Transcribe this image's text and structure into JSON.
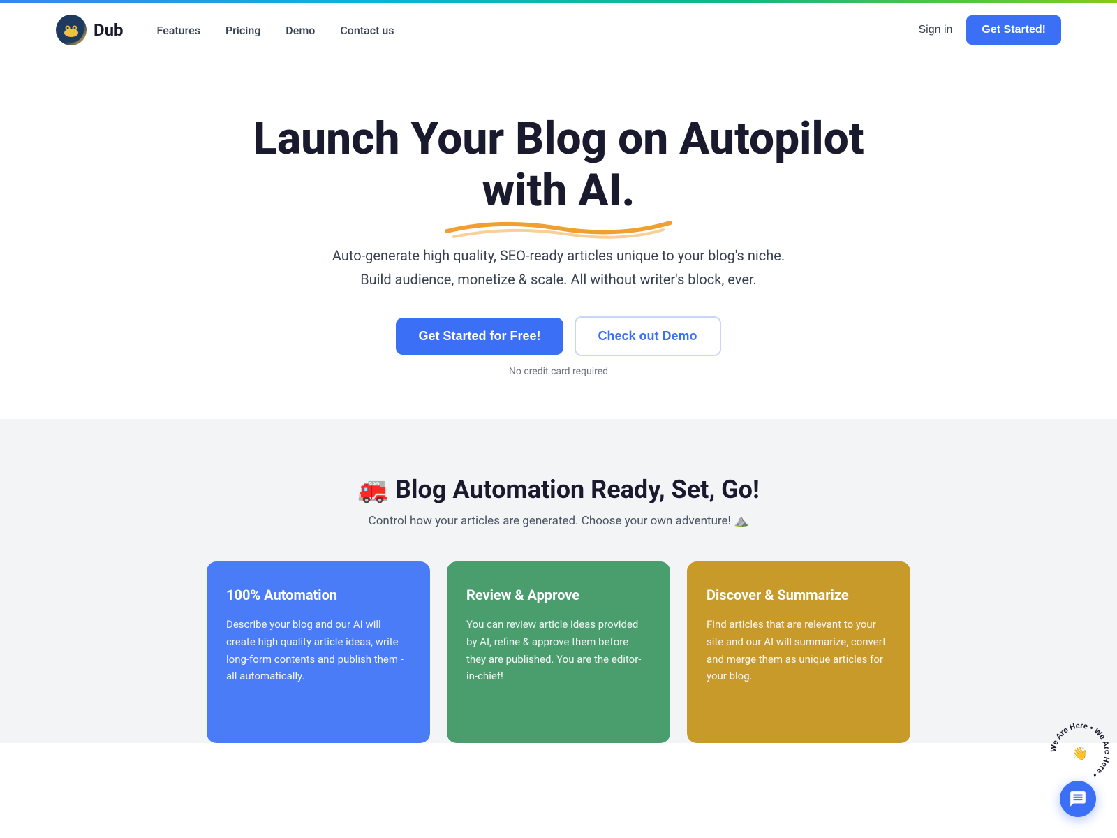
{
  "topbar": {},
  "navbar": {
    "logo_text": "Dub",
    "nav_items": [
      {
        "label": "Features",
        "id": "features"
      },
      {
        "label": "Pricing",
        "id": "pricing"
      },
      {
        "label": "Demo",
        "id": "demo"
      },
      {
        "label": "Contact us",
        "id": "contact"
      }
    ],
    "sign_in_label": "Sign in",
    "get_started_label": "Get Started!"
  },
  "hero": {
    "title_part1": "Launch Your Blog on Autopilot with AI.",
    "subtitle": "Auto-generate high quality, SEO-ready articles unique to your blog's niche. Build audience, monetize & scale. All without writer's block, ever.",
    "cta_primary": "Get Started for Free!",
    "cta_secondary": "Check out Demo",
    "no_credit": "No credit card required"
  },
  "features": {
    "title_emoji": "🚒",
    "title": "Blog Automation Ready, Set, Go!",
    "subtitle": "Control how your articles are generated. Choose your own adventure! ⛰️",
    "cards": [
      {
        "id": "automation",
        "title": "100% Automation",
        "text": "Describe your blog and our AI will create high quality article ideas, write long-form contents and publish them - all automatically.",
        "color": "blue"
      },
      {
        "id": "review",
        "title": "Review & Approve",
        "text": "You can review article ideas provided by AI, refine & approve them before they are published. You are the editor-in-chief!",
        "color": "green"
      },
      {
        "id": "discover",
        "title": "Discover & Summarize",
        "text": "Find articles that are relevant to your site and our AI will summarize, convert and merge them as unique articles for your blog.",
        "color": "yellow"
      }
    ]
  },
  "chat": {
    "label": "Chat"
  },
  "we_are_here": {
    "text": "We Are Here",
    "emoji": "👋"
  }
}
